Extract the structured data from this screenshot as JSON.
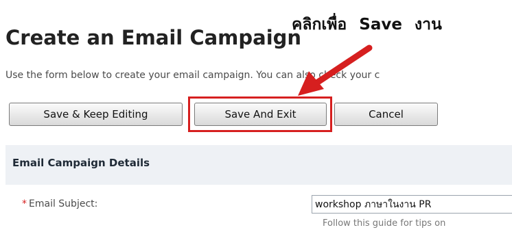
{
  "annotation": {
    "text": "คลิกเพื่อ Save งาน"
  },
  "page": {
    "title": "Create an Email Campaign",
    "subtitle": "Use the form below to create your email campaign. You can also check your c"
  },
  "toolbar": {
    "save_keep_label": "Save & Keep Editing",
    "save_exit_label": "Save And Exit",
    "cancel_label": "Cancel"
  },
  "section": {
    "title": "Email Campaign Details"
  },
  "fields": {
    "subject": {
      "required_marker": "*",
      "label": "Email Subject:",
      "value": "workshop ภาษาในงาน PR",
      "help": "Follow this guide for tips on"
    }
  },
  "colors": {
    "highlight": "#d61f1f",
    "panel_bg": "#eef1f5",
    "required": "#d61f1f"
  },
  "icons": {
    "arrow": "red-arrow-icon"
  }
}
